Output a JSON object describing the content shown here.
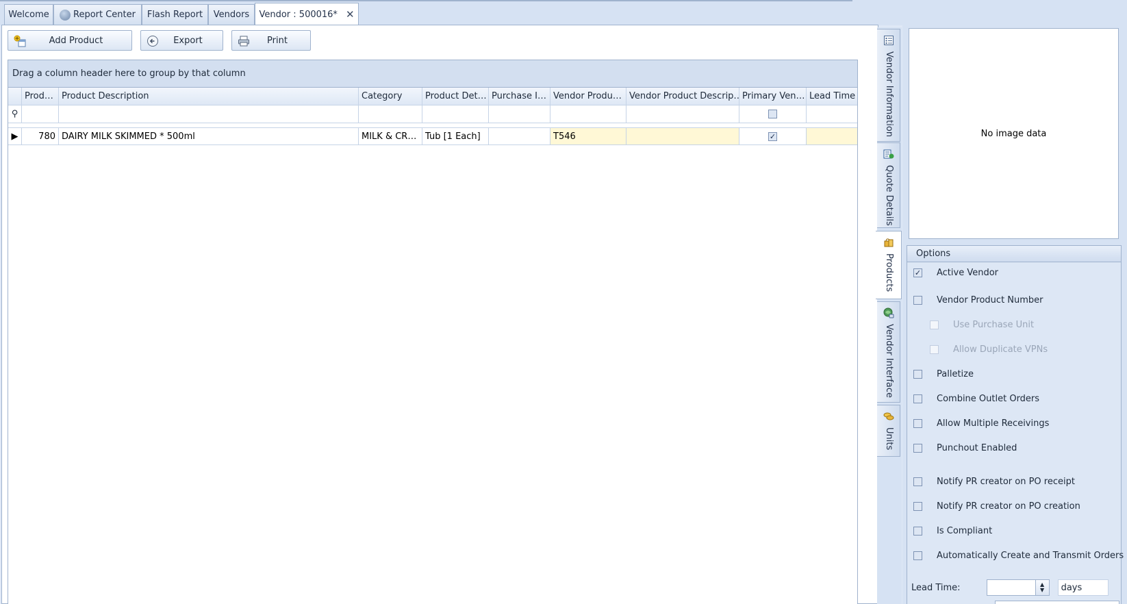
{
  "tabs": [
    {
      "label": "Welcome",
      "icon": ""
    },
    {
      "label": "Report Center",
      "icon": "report-center-icon"
    },
    {
      "label": "Flash Report",
      "icon": ""
    },
    {
      "label": "Vendors",
      "icon": ""
    },
    {
      "label": "Vendor : 500016*",
      "icon": "",
      "active": true
    }
  ],
  "tab_close_glyph": "✕",
  "toolbar": {
    "add_product": "Add Product",
    "export": "Export",
    "print": "Print"
  },
  "grid": {
    "group_hint": "Drag a column header here to group by that column",
    "filter_icon": "⚲",
    "row_indicator": "▶",
    "columns": [
      "Prod…",
      "Product Description",
      "Category",
      "Product Det…",
      "Purchase I…",
      "Vendor Produ…",
      "Vendor Product Descrip…",
      "Primary Ven…",
      "Lead Time"
    ],
    "rows": [
      {
        "product_number": "780",
        "description": "DAIRY MILK SKIMMED * 500ml",
        "category": "MILK & CR…",
        "product_detail": "Tub [1 Each]",
        "purchase_item": "",
        "vendor_product_number": "T546",
        "vendor_product_description": "",
        "primary_vendor": true,
        "lead_time": ""
      }
    ]
  },
  "side_tabs": [
    {
      "label": "Vendor Information",
      "icon": "vendor-information-icon"
    },
    {
      "label": "Quote Details",
      "icon": "quote-details-icon"
    },
    {
      "label": "Products",
      "icon": "products-icon",
      "active": true
    },
    {
      "label": "Vendor Interface",
      "icon": "vendor-interface-icon"
    },
    {
      "label": "Units",
      "icon": "units-icon"
    }
  ],
  "image": {
    "placeholder": "No image data"
  },
  "options": {
    "header": "Options",
    "items": [
      {
        "label": "Active Vendor",
        "checked": true
      },
      {
        "label": "Vendor Product Number",
        "checked": false
      },
      {
        "label": "Use Purchase Unit",
        "checked": false,
        "disabled": true
      },
      {
        "label": "Allow Duplicate VPNs",
        "checked": false,
        "disabled": true
      },
      {
        "label": "Palletize",
        "checked": false
      },
      {
        "label": "Combine Outlet Orders",
        "checked": false
      },
      {
        "label": "Allow Multiple Receivings",
        "checked": false
      },
      {
        "label": "Punchout Enabled",
        "checked": false
      },
      {
        "label": "Notify PR creator on PO receipt",
        "checked": false
      },
      {
        "label": "Notify PR creator on PO creation",
        "checked": false
      },
      {
        "label": "Is Compliant",
        "checked": false
      },
      {
        "label": "Automatically Create and Transmit Orders",
        "checked": false
      }
    ],
    "lead_time_label": "Lead Time:",
    "lead_time_value": "",
    "lead_time_unit": "days"
  },
  "colors": {
    "highlight_cell": "#fff8d6",
    "frame_blue": "#d6e2f3",
    "border": "#9fb2cd"
  }
}
